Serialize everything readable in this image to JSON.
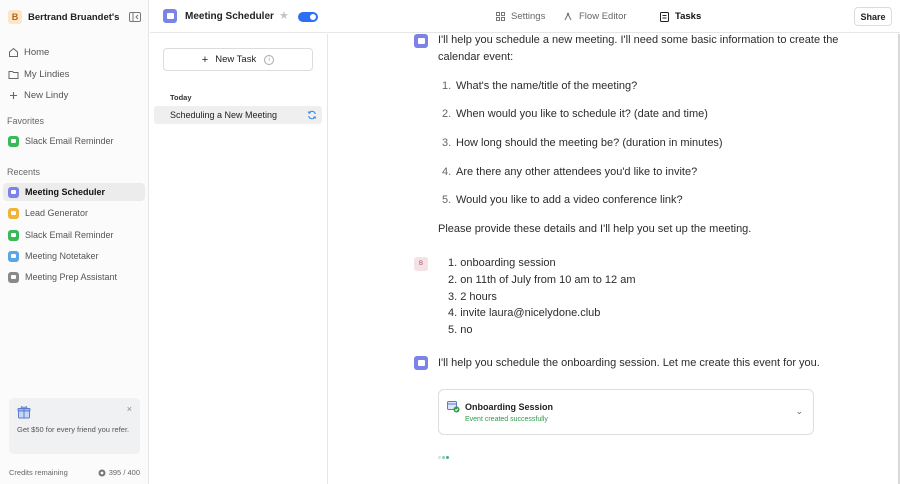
{
  "sidebar": {
    "workspace": {
      "initial": "B",
      "name": "Bertrand Bruandet's..."
    },
    "nav": [
      {
        "label": "Home",
        "icon": "home-icon"
      },
      {
        "label": "My Lindies",
        "icon": "folder-icon"
      },
      {
        "label": "New Lindy",
        "icon": "plus-icon"
      }
    ],
    "favorites_label": "Favorites",
    "favorites": [
      {
        "label": "Slack Email Reminder",
        "color": "#3bb85a"
      }
    ],
    "recents_label": "Recents",
    "recents": [
      {
        "label": "Meeting Scheduler",
        "color": "#7b82e8",
        "active": true
      },
      {
        "label": "Lead Generator",
        "color": "#f0b33a",
        "active": false
      },
      {
        "label": "Slack Email Reminder",
        "color": "#3bb85a",
        "active": false
      },
      {
        "label": "Meeting Notetaker",
        "color": "#5aa7e8",
        "active": false
      },
      {
        "label": "Meeting Prep Assistant",
        "color": "#8a8a8a",
        "active": false
      }
    ],
    "promo": {
      "text": "Get $50 for every friend you refer.",
      "close": "×"
    },
    "credits": {
      "label": "Credits remaining",
      "value": "395 / 400"
    }
  },
  "topbar": {
    "agent_name": "Meeting Scheduler",
    "toggle_on": true,
    "tabs": [
      {
        "label": "Settings",
        "icon": "grid-icon",
        "active": false
      },
      {
        "label": "Flow Editor",
        "icon": "flow-icon",
        "active": false
      },
      {
        "label": "Tasks",
        "icon": "tasks-icon",
        "active": true
      }
    ],
    "share_label": "Share"
  },
  "tasks_panel": {
    "new_task_label": "New Task",
    "group_label": "Today",
    "items": [
      {
        "label": "Scheduling a New Meeting"
      }
    ]
  },
  "chat": {
    "bot_intro": "I'll help you schedule a new meeting. I'll need some basic information to create the",
    "bot_intro_2": "calendar event:",
    "questions": [
      {
        "n": "1.",
        "text": "What's the name/title of the meeting?"
      },
      {
        "n": "2.",
        "text": "When would you like to schedule it? (date and time)"
      },
      {
        "n": "3.",
        "text": "How long should the meeting be? (duration in minutes)"
      },
      {
        "n": "4.",
        "text": "Are there any other attendees you'd like to invite?"
      },
      {
        "n": "5.",
        "text": "Would you like to add a video conference link?"
      }
    ],
    "bot_outro": "Please provide these details and I'll help you set up the meeting.",
    "user_initial": "B",
    "user_lines": [
      "1. onboarding session",
      "2. on 11th of July from 10 am to 12 am",
      "3. 2 hours",
      "4. invite laura@nicelydone.club",
      "5. no"
    ],
    "bot_reply": "I'll help you schedule the onboarding session. Let me create this event for you.",
    "event": {
      "title": "Onboarding Session",
      "status": "Event created successfully"
    }
  },
  "colors": {
    "accent": "#2d6ff4",
    "bot_icon": "#7b82e8",
    "success": "#2e9a4a"
  }
}
